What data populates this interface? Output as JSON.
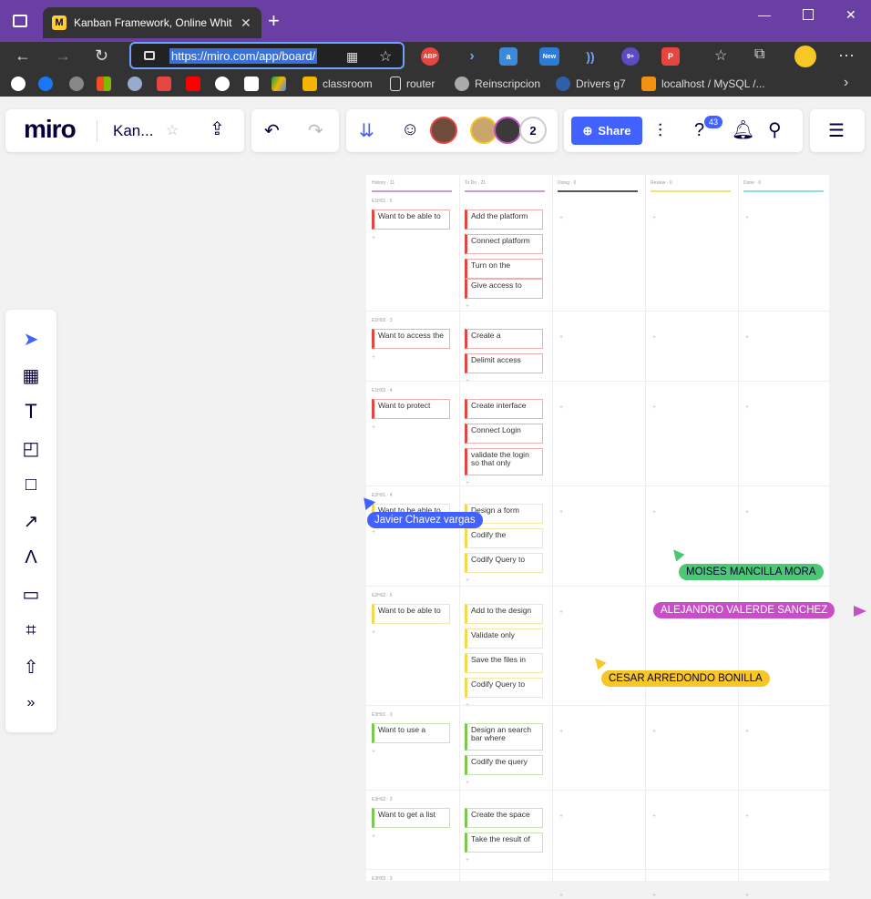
{
  "browser": {
    "tab_title": "Kanban Framework, Online Whit",
    "url": "https://miro.com/app/board/",
    "bookmarks": [
      "classroom",
      "router",
      "Reinscripcion",
      "Drivers g7",
      "localhost / MySQL /..."
    ]
  },
  "app": {
    "logo": "miro",
    "board_name": "Kan...",
    "share_label": "Share",
    "collaborators_count": "2",
    "help_badge": "43",
    "new_badge": "New",
    "ext_badge": "9+"
  },
  "colors": {
    "accent": "#4262ff",
    "titlebar": "#6a3fa3"
  },
  "kanban": {
    "columns": [
      {
        "label": "History · 11",
        "color": "#c79bd9"
      },
      {
        "label": "To Do · 21",
        "color": "#c79bd9"
      },
      {
        "label": "Doing · 0",
        "color": "#555555"
      },
      {
        "label": "Review · 0",
        "color": "#f2e27a"
      },
      {
        "label": "Done · 0",
        "color": "#8ee0e0"
      }
    ],
    "rows": [
      {
        "label": "E1H01 · 5",
        "history": "Want to be able to",
        "todo": [
          "Add the platform",
          "Connect platform",
          "Turn on the",
          "Give access to"
        ]
      },
      {
        "label": "E1H02 · 3",
        "history": "Want to access the",
        "todo": [
          "Create a",
          "Delimit access"
        ]
      },
      {
        "label": "E1H03 · 4",
        "history": "Want to protect",
        "todo": [
          "Create interface",
          "Connect Login",
          "validate the login so that only"
        ]
      },
      {
        "label": "E2H01 · 4",
        "history": "Want to be able to",
        "todo": [
          "Design a form",
          "Codify the",
          "Codify Query to"
        ]
      },
      {
        "label": "E2H02 · 5",
        "history": "Want to be able to",
        "todo": [
          "Add to the design",
          "Validate only",
          "Save the files in",
          "Codify Query to"
        ]
      },
      {
        "label": "E3H01 · 3",
        "history": "Want to use a",
        "todo": [
          "Design an search bar where",
          "Codify the query"
        ]
      },
      {
        "label": "E3H02 · 3",
        "history": "Want to get a list",
        "todo": [
          "Create the space",
          "Take the result of"
        ]
      },
      {
        "label": "E3H03 · 3",
        "history": "",
        "todo": []
      }
    ]
  },
  "cursors": [
    {
      "name": "Javier Chavez vargas",
      "color": "#4262ff",
      "text_color": "#ffffff"
    },
    {
      "name": "MOISES MANCILLA MORA",
      "color": "#4cc772",
      "text_color": "#050038"
    },
    {
      "name": "ALEJANDRO VALERDE SANCHEZ",
      "color": "#c84ec8",
      "text_color": "#ffffff"
    },
    {
      "name": "CESAR ARREDONDO BONILLA",
      "color": "#f7c627",
      "text_color": "#050038"
    }
  ]
}
